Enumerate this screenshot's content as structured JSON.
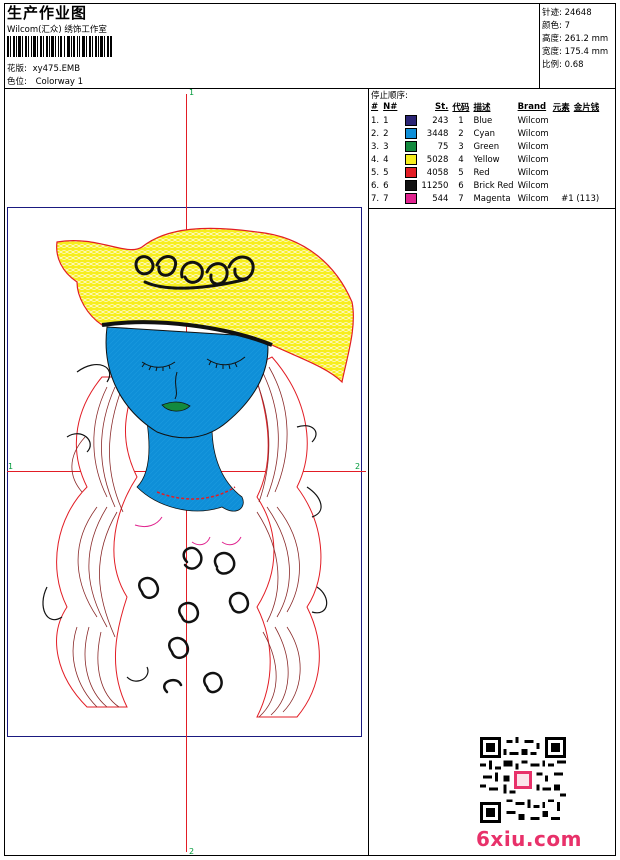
{
  "header": {
    "title": "生产作业图",
    "company": "Wilcom(汇众) 绣饰工作室",
    "design_label": "花版:",
    "design_value": "xy475.EMB",
    "colorway_label": "色位:",
    "colorway_value": "Colorway 1"
  },
  "stats": {
    "stitches_label": "针迹:",
    "stitches_value": "24648",
    "colors_label": "颜色:",
    "colors_value": "7",
    "height_label": "高度:",
    "height_value": "261.2 mm",
    "width_label": "宽度:",
    "width_value": "175.4 mm",
    "scale_label": "比例:",
    "scale_value": "0.68"
  },
  "stops": {
    "heading": "停止顺序:",
    "columns": [
      "#",
      "N#",
      "St.",
      "代码",
      "描述",
      "Brand",
      "元素",
      "金片钱"
    ],
    "rows": [
      {
        "n": "1.",
        "nn": "1",
        "color": "#2b2575",
        "st": "243",
        "code": "1",
        "desc": "Blue",
        "brand": "Wilcom",
        "elem": "",
        "seq": ""
      },
      {
        "n": "2.",
        "nn": "2",
        "color": "#0f8fd8",
        "st": "3448",
        "code": "2",
        "desc": "Cyan",
        "brand": "Wilcom",
        "elem": "",
        "seq": ""
      },
      {
        "n": "3.",
        "nn": "3",
        "color": "#138a3e",
        "st": "75",
        "code": "3",
        "desc": "Green",
        "brand": "Wilcom",
        "elem": "",
        "seq": ""
      },
      {
        "n": "4.",
        "nn": "4",
        "color": "#f7ee1e",
        "st": "5028",
        "code": "4",
        "desc": "Yellow",
        "brand": "Wilcom",
        "elem": "",
        "seq": ""
      },
      {
        "n": "5.",
        "nn": "5",
        "color": "#e21d25",
        "st": "4058",
        "code": "5",
        "desc": "Red",
        "brand": "Wilcom",
        "elem": "",
        "seq": ""
      },
      {
        "n": "6.",
        "nn": "6",
        "color": "#111111",
        "st": "11250",
        "code": "6",
        "desc": "Brick Red",
        "brand": "Wilcom",
        "elem": "",
        "seq": ""
      },
      {
        "n": "7.",
        "nn": "7",
        "color": "#e0238e",
        "st": "544",
        "code": "7",
        "desc": "Magenta",
        "brand": "Wilcom",
        "elem": "#1 (113)",
        "seq": ""
      }
    ]
  },
  "markers": {
    "top": "1",
    "bottom": "2",
    "left": "1",
    "right": "2"
  },
  "watermark": "6xiu.com",
  "colors": {
    "hat": "#f7ee1e",
    "skin": "#0f8fd8",
    "guide": "#e21d25",
    "hair": "#8a2a2a",
    "frame": "#1a1a80"
  }
}
